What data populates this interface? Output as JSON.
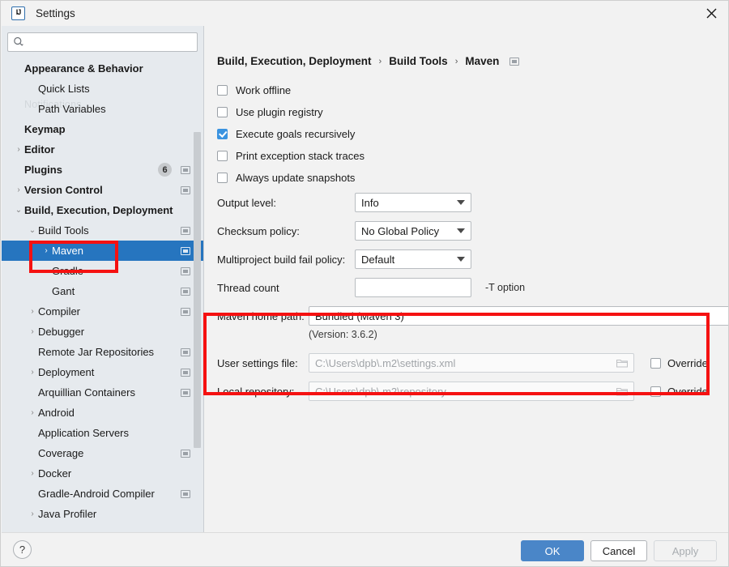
{
  "window": {
    "title": "Settings",
    "logo_icon": "intellij-idea-logo",
    "close_icon": "close-icon"
  },
  "sidebar": {
    "search": {
      "placeholder": "",
      "value": "",
      "icon": "search-icon"
    },
    "ghost_label": "Notifications",
    "items": [
      {
        "label": "Appearance & Behavior",
        "bold": true,
        "indent": 0,
        "arrow": "",
        "badge": "",
        "winicon": false
      },
      {
        "label": "Quick Lists",
        "bold": false,
        "indent": 1,
        "arrow": "",
        "badge": "",
        "winicon": false
      },
      {
        "label": "Path Variables",
        "bold": false,
        "indent": 1,
        "arrow": "",
        "badge": "",
        "winicon": false
      },
      {
        "label": "Keymap",
        "bold": true,
        "indent": 0,
        "arrow": "",
        "badge": "",
        "winicon": false
      },
      {
        "label": "Editor",
        "bold": true,
        "indent": 0,
        "arrow": "›",
        "badge": "",
        "winicon": false
      },
      {
        "label": "Plugins",
        "bold": true,
        "indent": 0,
        "arrow": "",
        "badge": "6",
        "winicon": true
      },
      {
        "label": "Version Control",
        "bold": true,
        "indent": 0,
        "arrow": "›",
        "badge": "",
        "winicon": true
      },
      {
        "label": "Build, Execution, Deployment",
        "bold": true,
        "indent": 0,
        "arrow": "⌄",
        "badge": "",
        "winicon": false
      },
      {
        "label": "Build Tools",
        "bold": false,
        "indent": 1,
        "arrow": "⌄",
        "badge": "",
        "winicon": true
      },
      {
        "label": "Maven",
        "bold": false,
        "indent": 2,
        "arrow": "›",
        "badge": "",
        "winicon": true,
        "selected": true
      },
      {
        "label": "Gradle",
        "bold": false,
        "indent": 2,
        "arrow": "",
        "badge": "",
        "winicon": true
      },
      {
        "label": "Gant",
        "bold": false,
        "indent": 2,
        "arrow": "",
        "badge": "",
        "winicon": true
      },
      {
        "label": "Compiler",
        "bold": false,
        "indent": 1,
        "arrow": "›",
        "badge": "",
        "winicon": true
      },
      {
        "label": "Debugger",
        "bold": false,
        "indent": 1,
        "arrow": "›",
        "badge": "",
        "winicon": false
      },
      {
        "label": "Remote Jar Repositories",
        "bold": false,
        "indent": 1,
        "arrow": "",
        "badge": "",
        "winicon": true
      },
      {
        "label": "Deployment",
        "bold": false,
        "indent": 1,
        "arrow": "›",
        "badge": "",
        "winicon": true
      },
      {
        "label": "Arquillian Containers",
        "bold": false,
        "indent": 1,
        "arrow": "",
        "badge": "",
        "winicon": true
      },
      {
        "label": "Android",
        "bold": false,
        "indent": 1,
        "arrow": "›",
        "badge": "",
        "winicon": false
      },
      {
        "label": "Application Servers",
        "bold": false,
        "indent": 1,
        "arrow": "",
        "badge": "",
        "winicon": false
      },
      {
        "label": "Coverage",
        "bold": false,
        "indent": 1,
        "arrow": "",
        "badge": "",
        "winicon": true
      },
      {
        "label": "Docker",
        "bold": false,
        "indent": 1,
        "arrow": "›",
        "badge": "",
        "winicon": false
      },
      {
        "label": "Gradle-Android Compiler",
        "bold": false,
        "indent": 1,
        "arrow": "",
        "badge": "",
        "winicon": true
      },
      {
        "label": "Java Profiler",
        "bold": false,
        "indent": 1,
        "arrow": "›",
        "badge": "",
        "winicon": false
      }
    ]
  },
  "breadcrumb": {
    "parts": [
      "Build, Execution, Deployment",
      "Build Tools",
      "Maven"
    ],
    "separator": "›",
    "trailing_icon": "window-icon"
  },
  "main": {
    "checkboxes": [
      {
        "label": "Work offline",
        "checked": false
      },
      {
        "label": "Use plugin registry",
        "checked": false
      },
      {
        "label": "Execute goals recursively",
        "checked": true
      },
      {
        "label": "Print exception stack traces",
        "checked": false
      },
      {
        "label": "Always update snapshots",
        "checked": false
      }
    ],
    "output_level": {
      "label": "Output level:",
      "value": "Info"
    },
    "checksum_policy": {
      "label": "Checksum policy:",
      "value": "No Global Policy"
    },
    "fail_policy": {
      "label": "Multiproject build fail policy:",
      "value": "Default"
    },
    "thread_count": {
      "label": "Thread count",
      "value": "",
      "hint": "-T option"
    },
    "maven_home": {
      "label": "Maven home path:",
      "value": "Bundled (Maven 3)",
      "version": "(Version: 3.6.2)",
      "browse_label": "..."
    },
    "user_settings": {
      "label": "User settings file:",
      "value": "C:\\Users\\dpb\\.m2\\settings.xml",
      "override_label": "Override",
      "override_checked": false,
      "browse_icon": "folder-icon"
    },
    "local_repo": {
      "label": "Local repository:",
      "value": "C:\\Users\\dpb\\.m2\\repository",
      "override_label": "Override",
      "override_checked": false,
      "browse_icon": "folder-icon"
    }
  },
  "footer": {
    "help_label": "?",
    "ok_label": "OK",
    "cancel_label": "Cancel",
    "apply_label": "Apply"
  },
  "annotations": {
    "accent_red": "#f51111",
    "selection_blue": "#2675bf",
    "primary_button_blue": "#4a86c8"
  }
}
